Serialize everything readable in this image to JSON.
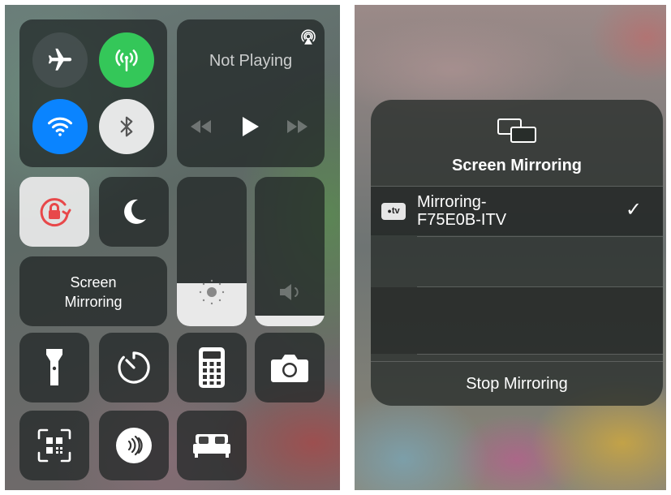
{
  "control_center": {
    "media": {
      "status_text": "Not Playing"
    },
    "screen_mirroring_tile": {
      "line1": "Screen",
      "line2": "Mirroring"
    },
    "colors": {
      "green": "#34c759",
      "blue": "#0a84ff",
      "lock_red": "#e8484a"
    },
    "icons": [
      "airplane-icon",
      "cellular-icon",
      "wifi-icon",
      "bluetooth-icon",
      "airplay-icon",
      "rewind-icon",
      "play-icon",
      "fast-forward-icon",
      "rotation-lock-icon",
      "moon-icon",
      "brightness-icon",
      "volume-icon",
      "flashlight-icon",
      "timer-icon",
      "calculator-icon",
      "camera-icon",
      "qr-scanner-icon",
      "nfc-icon",
      "bed-icon"
    ],
    "brightness_level": 0.29,
    "volume_level": 0.07
  },
  "mirroring_dialog": {
    "title": "Screen Mirroring",
    "device_badge": "tv",
    "device_name_line1": "Mirroring-",
    "device_name_line2": "F75E0B-ITV",
    "selected_mark": "✓",
    "stop_label": "Stop Mirroring"
  }
}
